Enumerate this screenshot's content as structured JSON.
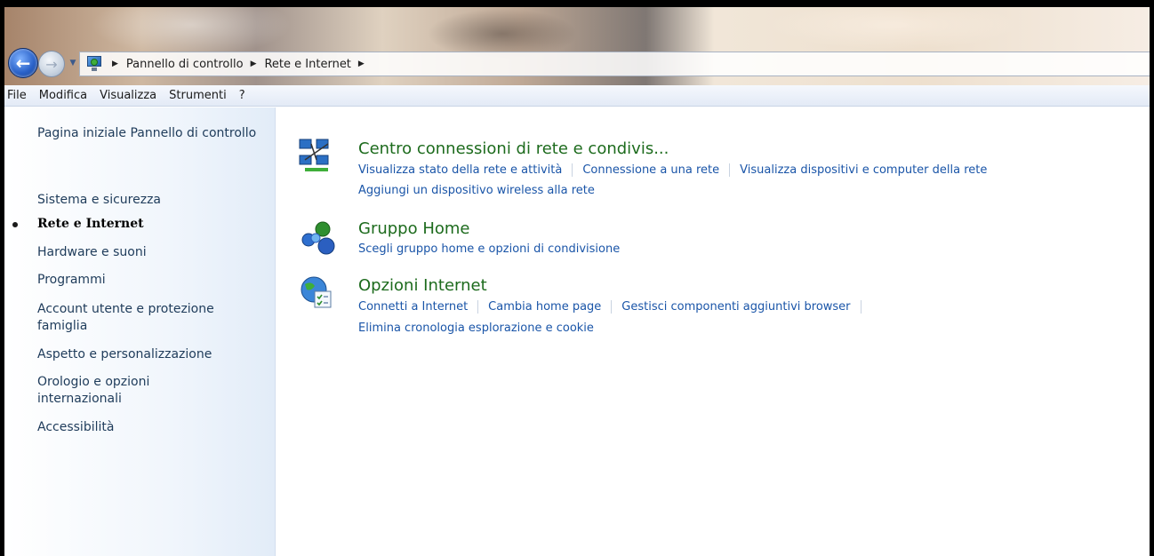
{
  "address": {
    "crumbs": [
      "Pannello di controllo",
      "Rete e Internet"
    ]
  },
  "menu": [
    "File",
    "Modifica",
    "Visualizza",
    "Strumenti",
    "?"
  ],
  "sidebar": {
    "items": [
      {
        "label": "Pagina iniziale Pannello di controllo"
      },
      {
        "label": "Sistema e sicurezza"
      },
      {
        "label": "Rete e Internet",
        "current": true
      },
      {
        "label": "Hardware e suoni"
      },
      {
        "label": "Programmi"
      },
      {
        "label": "Account utente e protezione famiglia"
      },
      {
        "label": "Aspetto e personalizzazione"
      },
      {
        "label": "Orologio e opzioni internazionali"
      },
      {
        "label": "Accessibilità"
      }
    ]
  },
  "categories": [
    {
      "title": "Centro connessioni di rete e condivis...",
      "icon": "network-center-icon",
      "links": [
        "Visualizza stato della rete e attività",
        "Connessione a una rete",
        "Visualizza dispositivi e computer della rete",
        "Aggiungi un dispositivo wireless alla rete"
      ]
    },
    {
      "title": "Gruppo Home",
      "icon": "homegroup-icon",
      "links": [
        "Scegli gruppo home e opzioni di condivisione"
      ]
    },
    {
      "title": "Opzioni Internet",
      "icon": "internet-options-icon",
      "links": [
        "Connetti a Internet",
        "Cambia home page",
        "Gestisci componenti aggiuntivi browser",
        "Elimina cronologia esplorazione e cookie"
      ]
    }
  ],
  "colors": {
    "category_title": "#1d6b1d",
    "link": "#1a55a8",
    "sidebar_text": "#1e3b5a"
  }
}
